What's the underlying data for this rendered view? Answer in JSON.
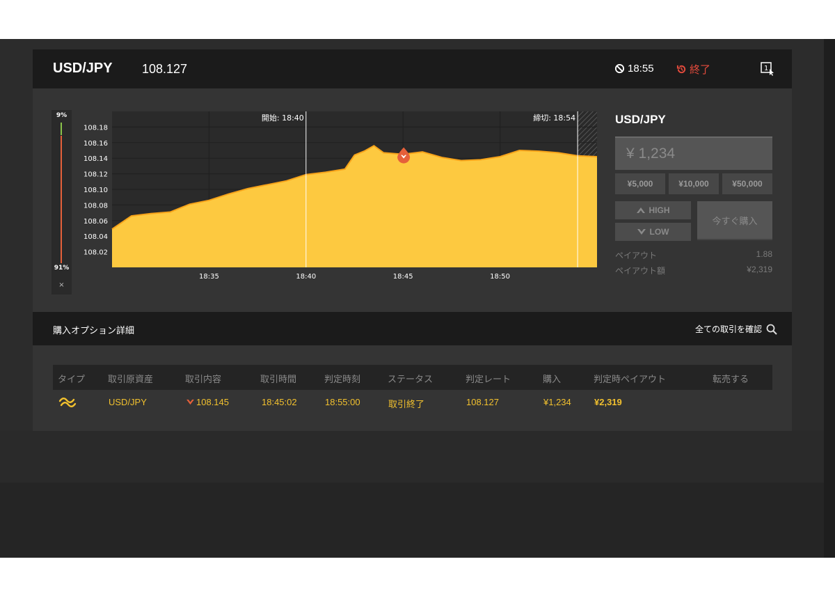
{
  "header": {
    "pair": "USD/JPY",
    "rate": "108.127",
    "clock": "18:55",
    "status": "終了"
  },
  "probability": {
    "top": "9%",
    "bottom": "91%",
    "close": "×",
    "high_fraction": 0.09
  },
  "chart_data": {
    "type": "area",
    "start_label": "開始: 18:40",
    "end_label": "締切: 18:54",
    "x_ticks": [
      "18:35",
      "18:40",
      "18:45",
      "18:50"
    ],
    "y_ticks": [
      "108.18",
      "108.16",
      "108.14",
      "108.12",
      "108.10",
      "108.08",
      "108.06",
      "108.04",
      "108.02"
    ],
    "ylim": [
      108.0,
      108.2
    ],
    "entry": {
      "time": "18:45:02",
      "rate": 108.145
    },
    "series": [
      {
        "x": [
          "18:30",
          "18:31",
          "18:32",
          "18:33",
          "18:34",
          "18:35",
          "18:36",
          "18:37",
          "18:38",
          "18:39",
          "18:40",
          "18:41",
          "18:42",
          "18:42:30",
          "18:43",
          "18:43:30",
          "18:44",
          "18:45",
          "18:46",
          "18:47",
          "18:48",
          "18:49",
          "18:50",
          "18:51",
          "18:52",
          "18:53",
          "18:54",
          "18:55"
        ],
        "y": [
          108.049,
          108.066,
          108.069,
          108.071,
          108.081,
          108.086,
          108.094,
          108.101,
          108.106,
          108.111,
          108.119,
          108.122,
          108.126,
          108.144,
          108.149,
          108.156,
          108.147,
          108.145,
          108.148,
          108.141,
          108.137,
          108.138,
          108.142,
          108.15,
          108.149,
          108.147,
          108.143,
          108.142
        ]
      }
    ],
    "colors": {
      "fill": "#fdc940",
      "line": "#f7a319",
      "marker": "#e5603a"
    }
  },
  "trade_panel": {
    "title": "USD/JPY",
    "amount_placeholder": "¥ 1,234",
    "presets": [
      "¥5,000",
      "¥10,000",
      "¥50,000"
    ],
    "high_label": "HIGH",
    "low_label": "LOW",
    "buy_label": "今すぐ購入",
    "payout_label": "ペイアウト",
    "payout_value": "1.88",
    "payout_amount_label": "ペイアウト額",
    "payout_amount_value": "¥2,319"
  },
  "options": {
    "title": "購入オプション詳細",
    "link": "全ての取引を確認"
  },
  "table": {
    "headers": [
      "タイプ",
      "取引原資産",
      "取引内容",
      "取引時間",
      "判定時刻",
      "ステータス",
      "判定レート",
      "購入",
      "判定時ペイアウト",
      "転売する"
    ],
    "row": {
      "asset": "USD/JPY",
      "direction": "108.145",
      "trade_time": "18:45:02",
      "judge_time": "18:55:00",
      "status": "取引終了",
      "judge_rate": "108.127",
      "purchase": "¥1,234",
      "payout": "¥2,319"
    }
  },
  "colors": {
    "accent": "#f2c12e",
    "danger": "#e54b3c",
    "panel": "#343434",
    "header": "#1b1b1b"
  }
}
